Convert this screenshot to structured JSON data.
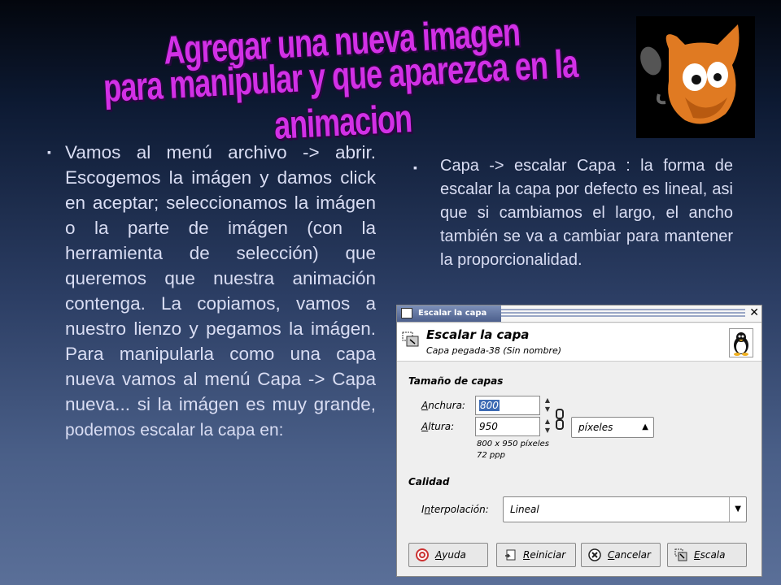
{
  "slide": {
    "title_line1": "Agregar una nueva imagen",
    "title_line2": "para manipular y que aparezca en la animacion",
    "left_text": "Vamos al menú archivo -> abrir. Escogemos la imágen y damos click en aceptar; seleccionamos la imágen o la parte de imágen (con la herramienta de selección) que queremos que nuestra animación contenga. La copiamos, vamos a nuestro lienzo y pegamos la imágen. Para manipularla como una capa nueva vamos al menú Capa -> Capa nueva... si la imágen es muy grande,",
    "left_tail": "podemos escalar la capa en:",
    "right_text": "Capa -> escalar Capa : la forma de escalar la capa por defecto es lineal, asi que si cambiamos el largo, el ancho también se va a cambiar para mantener la proporcionalidad.",
    "bullet": "▪"
  },
  "dialog": {
    "window_title": "Escalar la capa",
    "header_title": "Escalar la capa",
    "header_subtitle": "Capa pegada-38 (Sin nombre)",
    "section_size": "Tamaño de capas",
    "width_label_u": "A",
    "width_label_rest": "nchura:",
    "width_value": "800",
    "height_label_u": "A",
    "height_label_rest": "ltura:",
    "height_value": "950",
    "unit": "píxeles",
    "info_size": "800 x 950 píxeles",
    "info_res": "72 ppp",
    "section_quality": "Calidad",
    "interp_label_pre": "I",
    "interp_label_u": "n",
    "interp_label_rest": "terpolación:",
    "interp_value": "Lineal",
    "btn_help_u": "A",
    "btn_help_rest": "yuda",
    "btn_reset_u": "R",
    "btn_reset_rest": "einiciar",
    "btn_cancel_u": "C",
    "btn_cancel_rest": "ancelar",
    "btn_scale_u": "E",
    "btn_scale_rest": "scala"
  },
  "colors": {
    "title_magenta": "#d230e6",
    "text": "#d9ddf3",
    "selection": "#3d6bb3"
  },
  "icons": [
    "gimp-logo-icon",
    "scale-layer-icon",
    "tux-penguin-icon",
    "chain-link-icon",
    "help-lifebuoy-icon",
    "reset-icon",
    "cancel-x-icon",
    "scale-icon"
  ]
}
